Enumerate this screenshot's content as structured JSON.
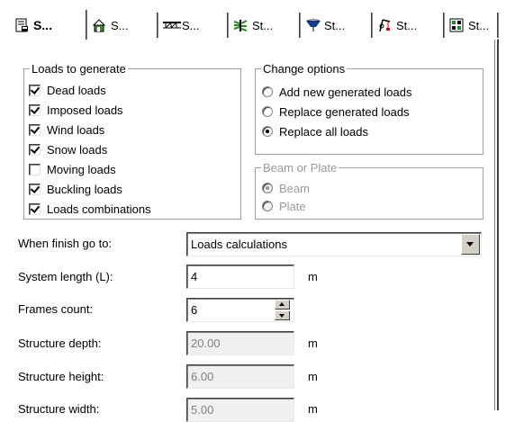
{
  "tabs": [
    {
      "label": "S...",
      "icon": "document-properties-icon",
      "active": true
    },
    {
      "label": "S...",
      "icon": "building-icon",
      "active": false
    },
    {
      "label": "S...",
      "icon": "beam-structure-icon",
      "active": false
    },
    {
      "label": "St...",
      "icon": "wind-icon",
      "active": false
    },
    {
      "label": "St...",
      "icon": "snow-roof-icon",
      "active": false
    },
    {
      "label": "St...",
      "icon": "crane-icon",
      "active": false
    },
    {
      "label": "St...",
      "icon": "frame-grid-icon",
      "active": false
    }
  ],
  "loads": {
    "title": "Loads to generate",
    "items": [
      {
        "label": "Dead loads",
        "checked": true
      },
      {
        "label": "Imposed loads",
        "checked": true
      },
      {
        "label": "Wind loads",
        "checked": true
      },
      {
        "label": "Snow loads",
        "checked": true
      },
      {
        "label": "Moving loads",
        "checked": false
      },
      {
        "label": "Buckling loads",
        "checked": true
      },
      {
        "label": "Loads combinations",
        "checked": true
      }
    ]
  },
  "change_options": {
    "title": "Change options",
    "items": [
      {
        "label": "Add new generated loads",
        "selected": false
      },
      {
        "label": "Replace generated loads",
        "selected": false
      },
      {
        "label": "Replace all loads",
        "selected": true
      }
    ]
  },
  "beam_or_plate": {
    "title": "Beam or Plate",
    "items": [
      {
        "label": "Beam",
        "selected": true
      },
      {
        "label": "Plate",
        "selected": false
      }
    ]
  },
  "form": {
    "when_finish": {
      "label": "When finish go to:",
      "value": "Loads calculations"
    },
    "system_length": {
      "label": "System length (L):",
      "value": "4",
      "unit": "m"
    },
    "frames_count": {
      "label": "Frames count:",
      "value": "6"
    },
    "structure_depth": {
      "label": "Structure depth:",
      "value": "20.00",
      "unit": "m"
    },
    "structure_height": {
      "label": "Structure height:",
      "value": "6.00",
      "unit": "m"
    },
    "structure_width": {
      "label": "Structure width:",
      "value": "5.00",
      "unit": "m"
    }
  }
}
